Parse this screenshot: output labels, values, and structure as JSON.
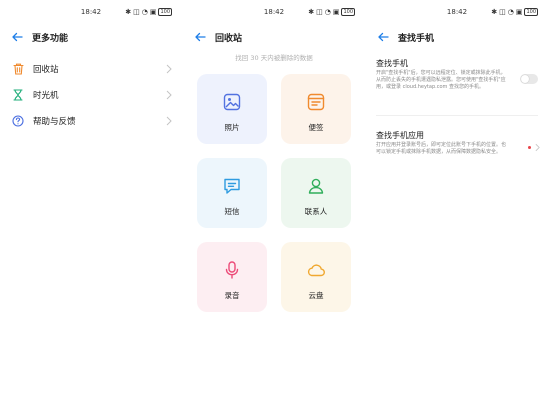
{
  "colors": {
    "accent": "#1e7ee8",
    "red_dot": "#e8444a",
    "tile_blue": "#eef2fd",
    "tile_orange": "#fdf3ea",
    "tile_cyan": "#edf6fc",
    "tile_green": "#edf7ef",
    "tile_pink": "#fdeef2",
    "tile_yellow": "#fdf6e8",
    "icon_recycle": "#f08a2e",
    "icon_timemachine": "#1fae7a",
    "icon_help": "#4a6ee0"
  },
  "status_bar": {
    "time": "18:42",
    "icons": [
      "bluetooth-icon",
      "vibrate-icon",
      "wifi-icon",
      "sim-icon",
      "battery-icon"
    ],
    "battery_text": "100"
  },
  "panel_more": {
    "title": "更多功能",
    "items": [
      {
        "label": "回收站",
        "icon": "trash-icon"
      },
      {
        "label": "时光机",
        "icon": "hourglass-icon"
      },
      {
        "label": "帮助与反馈",
        "icon": "help-icon"
      }
    ]
  },
  "panel_recycle": {
    "title": "回收站",
    "hint": "找回 30 天内被删除的数据",
    "tiles": [
      {
        "label": "照片",
        "icon": "photo-icon"
      },
      {
        "label": "便签",
        "icon": "notes-icon"
      },
      {
        "label": "短信",
        "icon": "message-icon"
      },
      {
        "label": "联系人",
        "icon": "contact-icon"
      },
      {
        "label": "录音",
        "icon": "microphone-icon"
      },
      {
        "label": "云盘",
        "icon": "cloud-icon"
      }
    ]
  },
  "panel_find": {
    "title": "查找手机",
    "find_phone": {
      "title": "查找手机",
      "description": "开启\"查找手机\"后，您可以远程定位、锁定或抹除此手机，从而防止丢失的手机遭遇隐私泄露。您可使用\"查找手机\"应用，或登录 cloud.heytap.com 查找您的手机。"
    },
    "find_app": {
      "title": "查找手机应用",
      "description": "打开应用并登录账号后，即可定位此账号下手机的位置。也可以锁定手机或抹除手机数据，从而保障数据隐私安全。"
    }
  }
}
